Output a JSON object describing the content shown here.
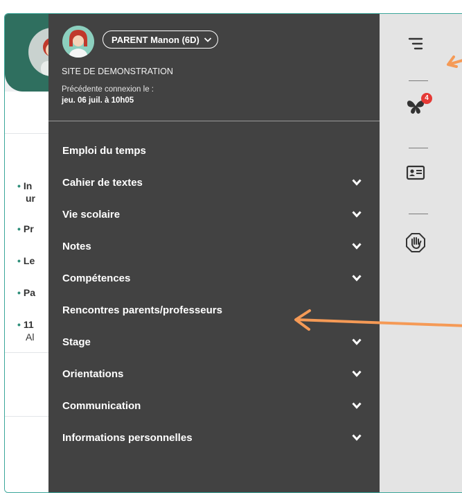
{
  "parent_selector": {
    "label": "PARENT Manon (6D)",
    "chevron_icon": "chevron-down-icon"
  },
  "site_name": "SITE DE DEMONSTRATION",
  "last_connection": {
    "label": "Précédente connexion le :",
    "value": "jeu. 06 juil. à 10h05"
  },
  "menu": [
    {
      "label": "Emploi du temps",
      "expandable": false
    },
    {
      "label": "Cahier de textes",
      "expandable": true
    },
    {
      "label": "Vie scolaire",
      "expandable": true
    },
    {
      "label": "Notes",
      "expandable": true
    },
    {
      "label": "Compétences",
      "expandable": true
    },
    {
      "label": "Rencontres parents/professeurs",
      "expandable": false
    },
    {
      "label": "Stage",
      "expandable": true
    },
    {
      "label": "Orientations",
      "expandable": true
    },
    {
      "label": "Communication",
      "expandable": true
    },
    {
      "label": "Informations personnelles",
      "expandable": true
    }
  ],
  "rail": {
    "menu_icon": "menu-lines-icon",
    "notifications_icon": "butterfly-icon",
    "notifications_count": "4",
    "id_card_icon": "id-card-icon",
    "stop_icon": "hand-stop-icon"
  },
  "background_list": [
    {
      "text": "In",
      "text2": "ur"
    },
    {
      "text": "Pr"
    },
    {
      "text": "Le"
    },
    {
      "text": "Pa"
    },
    {
      "text": "11",
      "text2": "Al"
    }
  ],
  "colors": {
    "drawer_bg": "#424242",
    "rail_bg": "#e4e4e4",
    "accent_teal": "#2f6f5f",
    "annotation_orange": "#f59a56",
    "badge_red": "#e53935"
  }
}
